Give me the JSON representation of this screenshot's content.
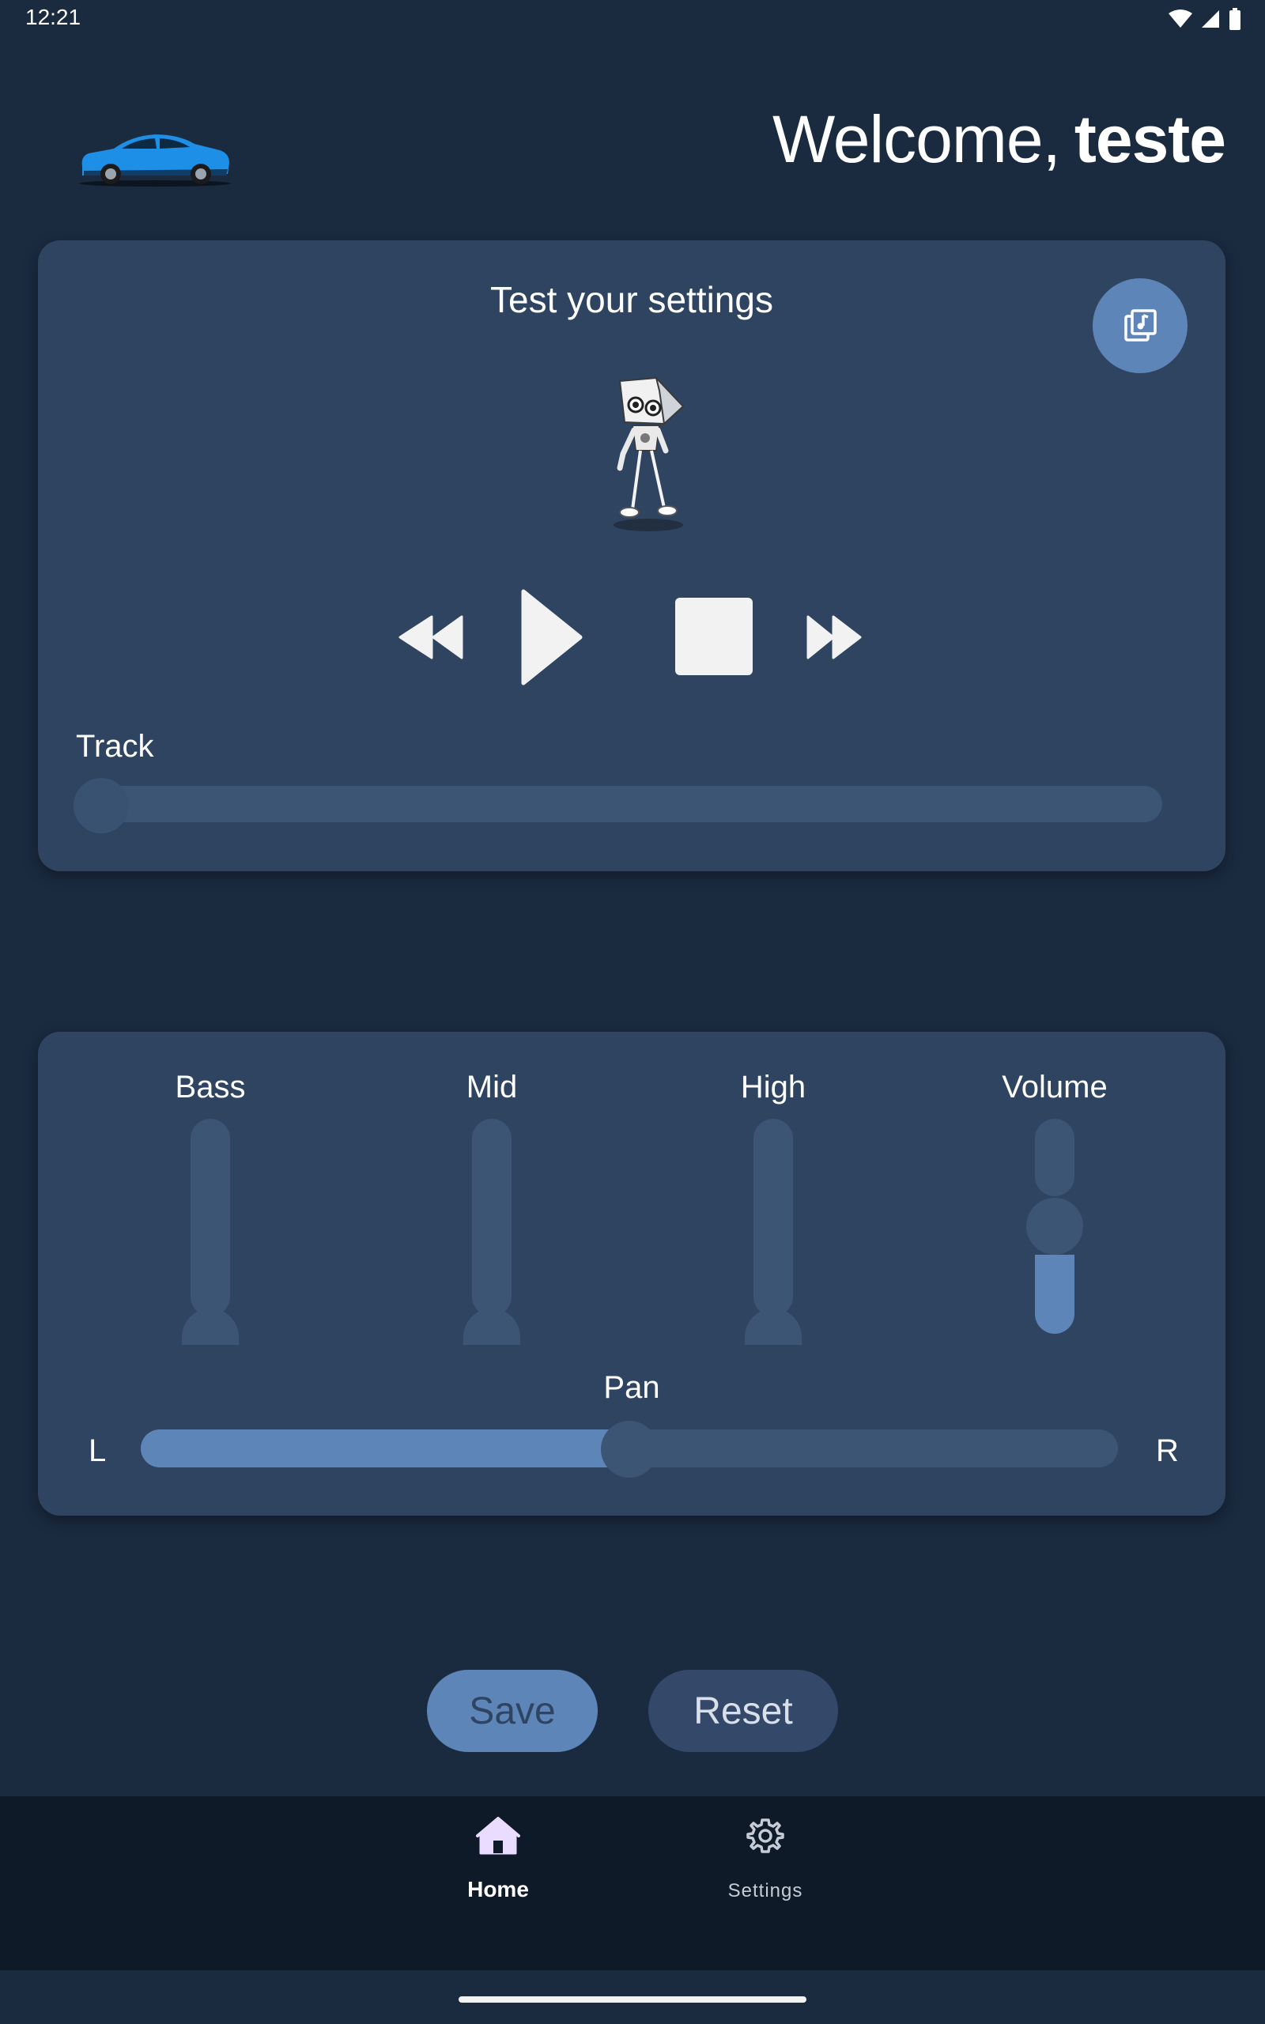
{
  "status_bar": {
    "time": "12:21"
  },
  "header": {
    "welcome_prefix": "Welcome,",
    "username": "teste"
  },
  "player": {
    "title": "Test your settings",
    "track_label": "Track",
    "track_progress": 0
  },
  "equalizer": {
    "bass_label": "Bass",
    "mid_label": "Mid",
    "high_label": "High",
    "volume_label": "Volume",
    "bass_level": 0,
    "mid_level": 0,
    "high_level": 0,
    "volume_level": 0.38,
    "pan_label": "Pan",
    "pan_left": "L",
    "pan_right": "R",
    "pan_value": 0.5
  },
  "actions": {
    "save_label": "Save",
    "reset_label": "Reset"
  },
  "nav": {
    "home_label": "Home",
    "settings_label": "Settings"
  },
  "colors": {
    "background": "#1a2a3f",
    "card": "#2e4461",
    "accent": "#5d85b8",
    "rail": "#3d5575",
    "navbar": "#0f1a29"
  }
}
